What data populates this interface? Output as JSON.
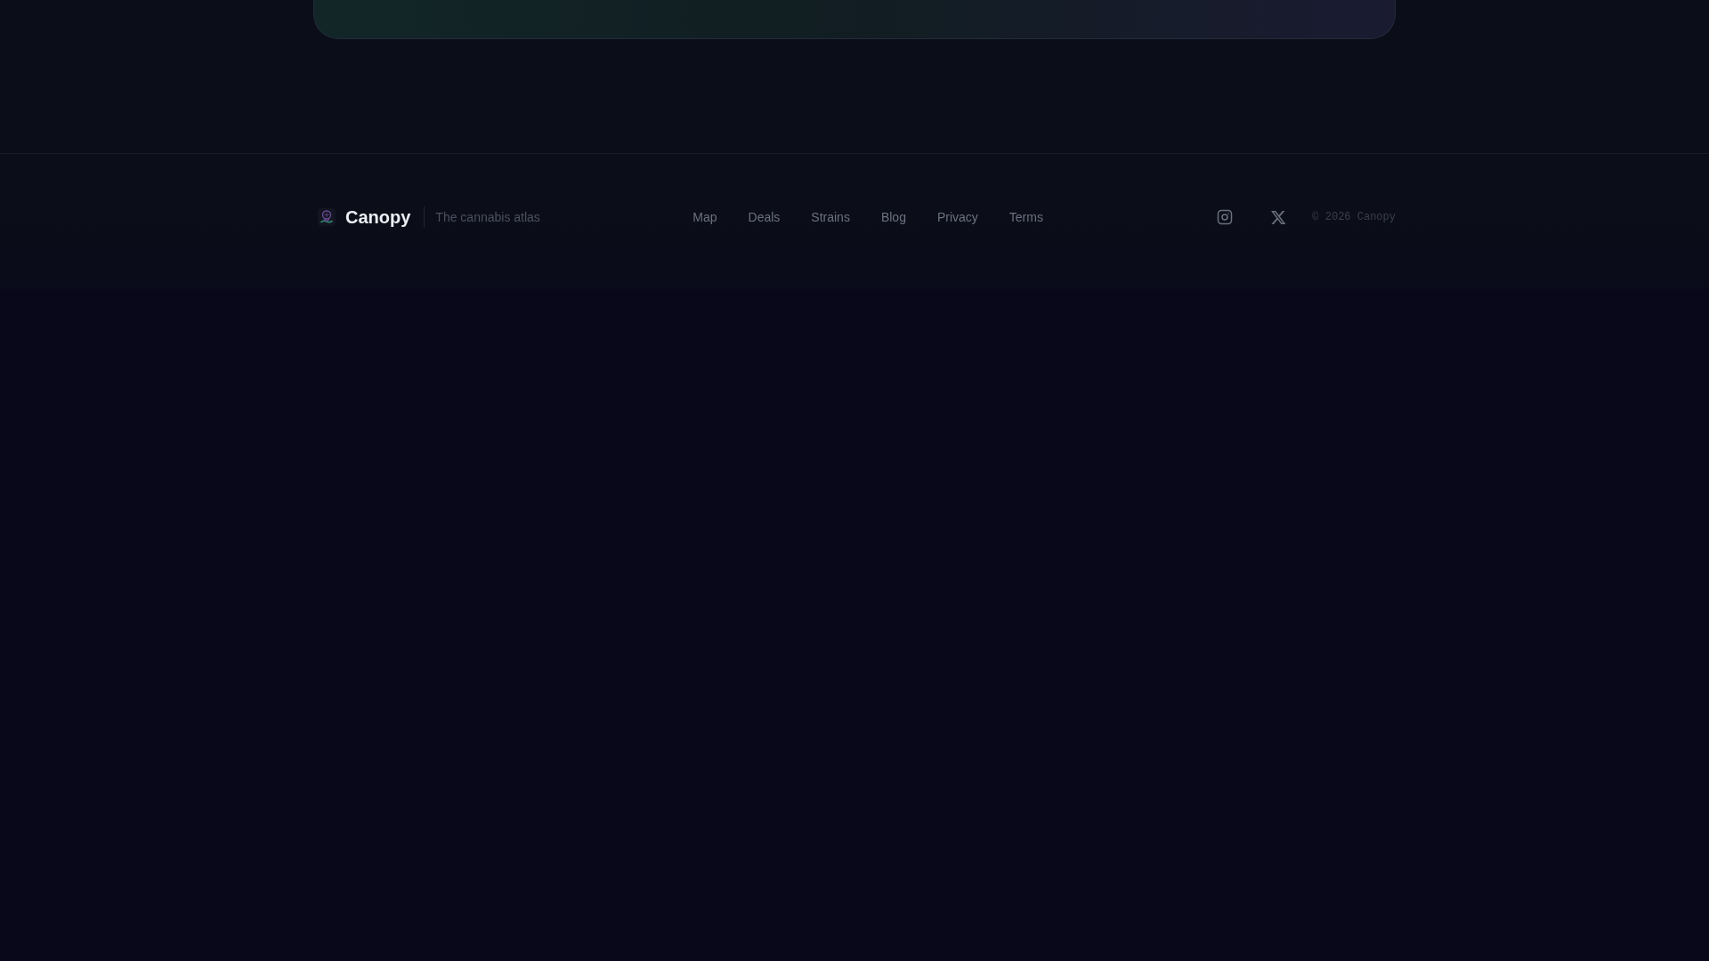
{
  "footer": {
    "brand": {
      "name": "Canopy",
      "tagline": "The cannabis atlas"
    },
    "nav_links": [
      "Map",
      "Deals",
      "Strains",
      "Blog",
      "Privacy",
      "Terms"
    ],
    "social_links": [
      {
        "kind": "instagram"
      },
      {
        "kind": "x"
      }
    ],
    "copyright": "© 2026 Canopy"
  }
}
